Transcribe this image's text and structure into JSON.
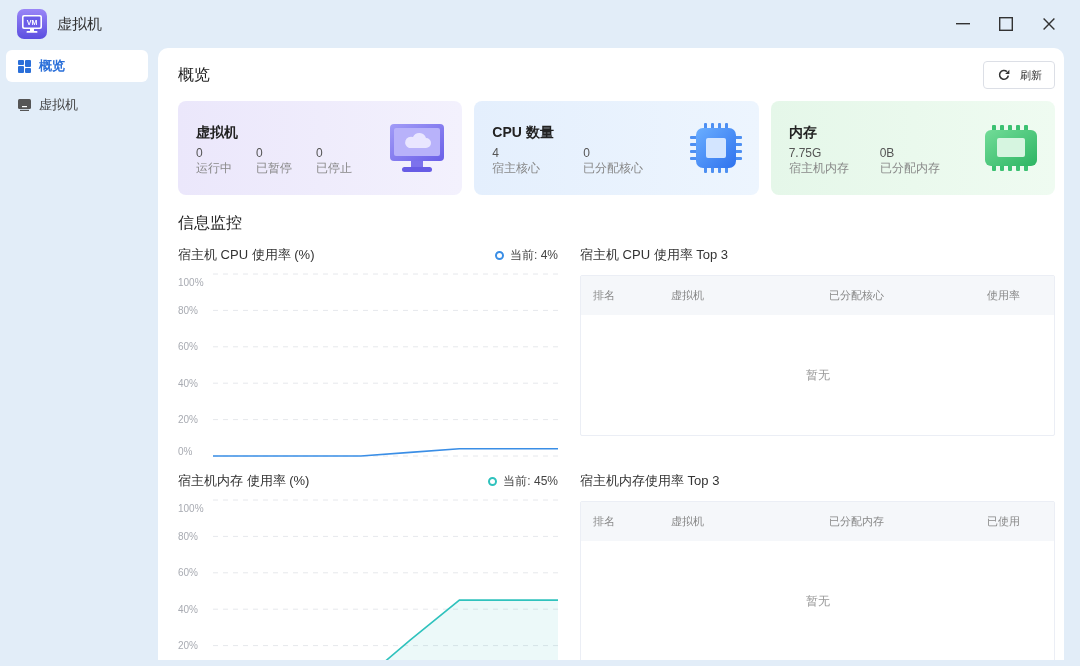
{
  "window": {
    "title": "虚拟机",
    "logo_text": "VM"
  },
  "sidebar": {
    "items": [
      {
        "kind": "overview",
        "label": "概览",
        "selected": true
      },
      {
        "kind": "vm",
        "label": "虚拟机",
        "selected": false
      }
    ]
  },
  "overview": {
    "title": "概览",
    "refresh_button": "刷新",
    "cards": [
      {
        "kind": "vm",
        "title": "虚拟机",
        "stats": [
          {
            "value": "0",
            "label": "运行中"
          },
          {
            "value": "0",
            "label": "已暂停"
          },
          {
            "value": "0",
            "label": "已停止"
          }
        ]
      },
      {
        "kind": "cpu",
        "title": "CPU 数量",
        "stats": [
          {
            "value": "4",
            "label": "宿主核心"
          },
          {
            "value": "0",
            "label": "已分配核心"
          }
        ]
      },
      {
        "kind": "memory",
        "title": "内存",
        "stats": [
          {
            "value": "7.75G",
            "label": "宿主机内存"
          },
          {
            "value": "0B",
            "label": "已分配内存"
          }
        ]
      }
    ]
  },
  "monitoring": {
    "title": "信息监控",
    "rows": [
      {
        "chart_data": {
          "type": "line",
          "title": "宿主机 CPU 使用率 (%)",
          "grid": true,
          "ylim": [
            0,
            100
          ],
          "yticks": [
            {
              "value": 0,
              "label": "0%"
            },
            {
              "value": 20,
              "label": "20%"
            },
            {
              "value": 40,
              "label": "40%"
            },
            {
              "value": 60,
              "label": "60%"
            },
            {
              "value": 80,
              "label": "80%"
            },
            {
              "value": 100,
              "label": "100%"
            }
          ],
          "series": [
            {
              "name": "当前: 4%",
              "color": "#3a8ee6",
              "values": [
                0,
                0,
                0,
                0,
                2,
                4,
                4,
                4
              ]
            }
          ]
        },
        "table": {
          "title": "宿主机 CPU 使用率 Top 3",
          "columns": [
            "排名",
            "虚拟机",
            "已分配核心",
            "使用率"
          ],
          "empty_text": "暂无"
        }
      },
      {
        "chart_data": {
          "type": "area",
          "title": "宿主机内存 使用率 (%)",
          "grid": true,
          "ylim": [
            0,
            100
          ],
          "yticks": [
            {
              "value": 20,
              "label": "20%"
            },
            {
              "value": 40,
              "label": "40%"
            },
            {
              "value": 60,
              "label": "60%"
            },
            {
              "value": 80,
              "label": "80%"
            },
            {
              "value": 100,
              "label": "100%"
            }
          ],
          "series": [
            {
              "name": "当前: 45%",
              "color": "#2fc2bd",
              "values": [
                null,
                null,
                null,
                0,
                23,
                45,
                45,
                45
              ]
            }
          ]
        },
        "table": {
          "title": "宿主机内存使用率 Top 3",
          "columns": [
            "排名",
            "虚拟机",
            "已分配内存",
            "已使用"
          ],
          "empty_text": "暂无"
        }
      }
    ]
  }
}
